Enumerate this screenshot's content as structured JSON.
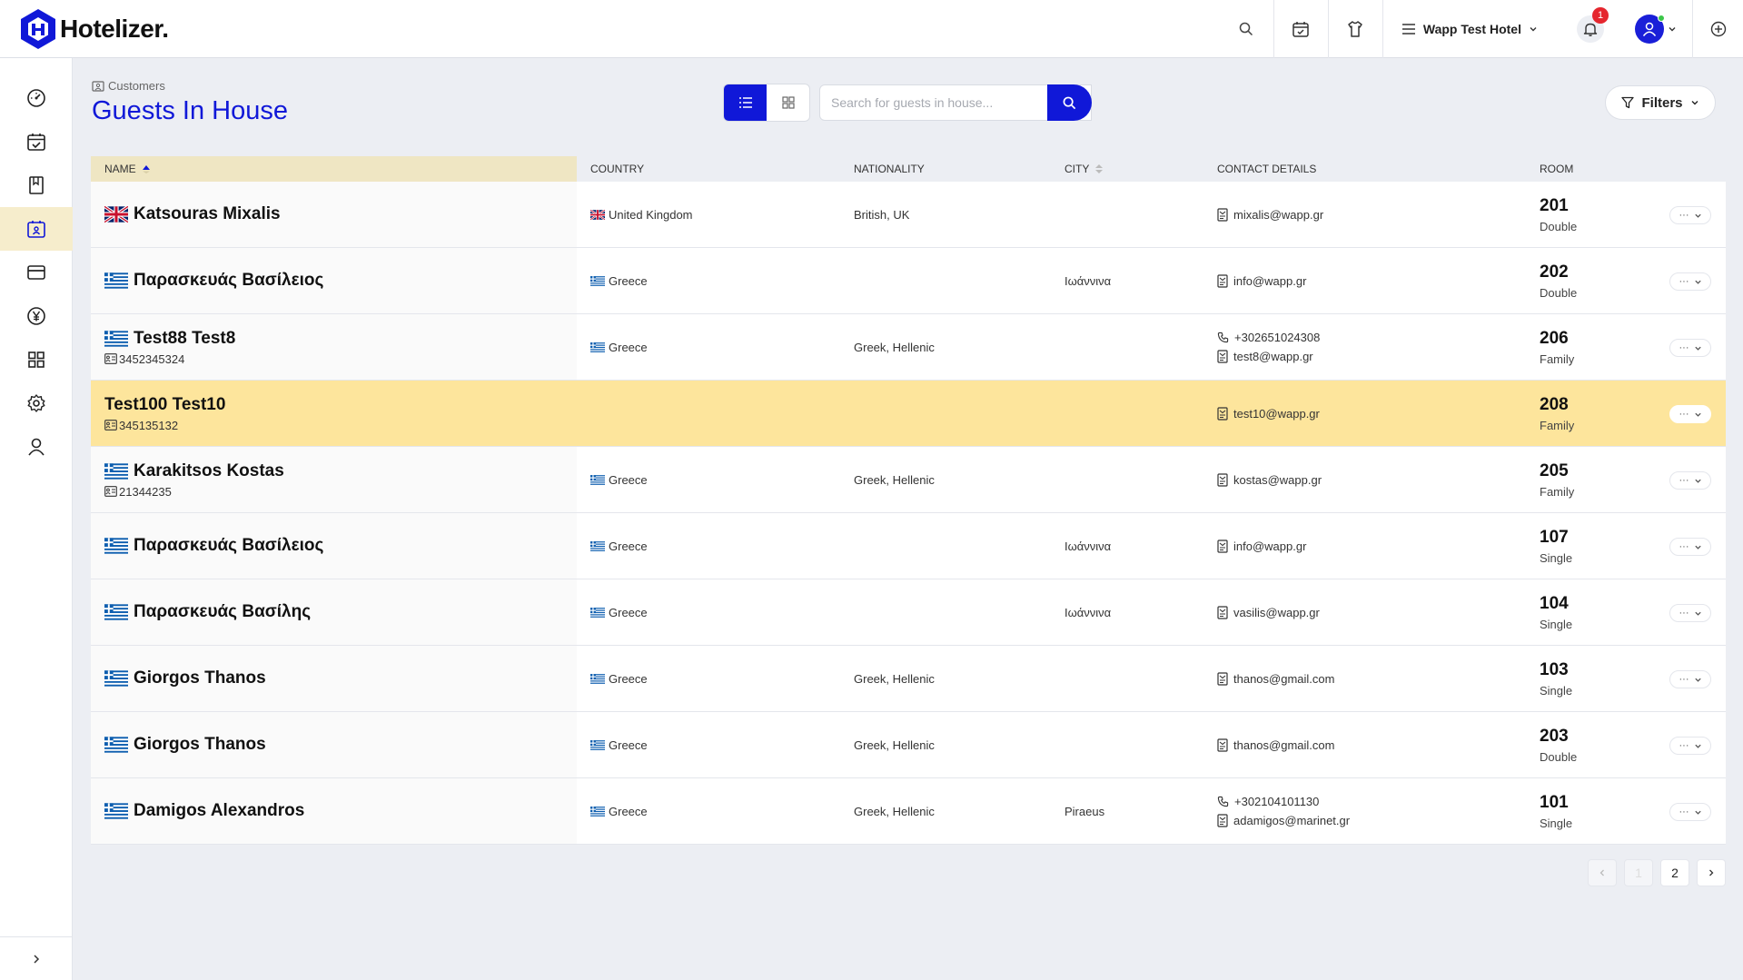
{
  "app": {
    "name": "Hotelizer."
  },
  "topbar": {
    "hotel_name": "Wapp Test Hotel",
    "notification_count": "1"
  },
  "breadcrumb": {
    "label": "Customers"
  },
  "page": {
    "title": "Guests In House"
  },
  "search": {
    "placeholder": "Search for guests in house..."
  },
  "filters": {
    "label": "Filters"
  },
  "columns": {
    "name": "NAME",
    "country": "COUNTRY",
    "nationality": "NATIONALITY",
    "city": "CITY",
    "contact": "CONTACT DETAILS",
    "room": "ROOM"
  },
  "guests": [
    {
      "name": "Katsouras Mixalis",
      "flag": "uk",
      "id": "",
      "country": "United Kingdom",
      "country_flag": "uk",
      "nationality": "British, UK",
      "city": "",
      "phone": "",
      "email": "mixalis@wapp.gr",
      "room": "201",
      "room_type": "Double",
      "highlight": false
    },
    {
      "name": "Παρασκευάς Βασίλειος",
      "flag": "gr",
      "id": "",
      "country": "Greece",
      "country_flag": "gr",
      "nationality": "",
      "city": "Ιωάννινα",
      "phone": "",
      "email": "info@wapp.gr",
      "room": "202",
      "room_type": "Double",
      "highlight": false
    },
    {
      "name": "Test88 Test8",
      "flag": "gr",
      "id": "3452345324",
      "country": "Greece",
      "country_flag": "gr",
      "nationality": "Greek, Hellenic",
      "city": "",
      "phone": "+302651024308",
      "email": "test8@wapp.gr",
      "room": "206",
      "room_type": "Family",
      "highlight": false
    },
    {
      "name": "Test100 Test10",
      "flag": "",
      "id": "345135132",
      "country": "",
      "country_flag": "",
      "nationality": "",
      "city": "",
      "phone": "",
      "email": "test10@wapp.gr",
      "room": "208",
      "room_type": "Family",
      "highlight": true
    },
    {
      "name": "Karakitsos Kostas",
      "flag": "gr",
      "id": "21344235",
      "country": "Greece",
      "country_flag": "gr",
      "nationality": "Greek, Hellenic",
      "city": "",
      "phone": "",
      "email": "kostas@wapp.gr",
      "room": "205",
      "room_type": "Family",
      "highlight": false
    },
    {
      "name": "Παρασκευάς Βασίλειος",
      "flag": "gr",
      "id": "",
      "country": "Greece",
      "country_flag": "gr",
      "nationality": "",
      "city": "Ιωάννινα",
      "phone": "",
      "email": "info@wapp.gr",
      "room": "107",
      "room_type": "Single",
      "highlight": false
    },
    {
      "name": "Παρασκευάς Βασίλης",
      "flag": "gr",
      "id": "",
      "country": "Greece",
      "country_flag": "gr",
      "nationality": "",
      "city": "Ιωάννινα",
      "phone": "",
      "email": "vasilis@wapp.gr",
      "room": "104",
      "room_type": "Single",
      "highlight": false
    },
    {
      "name": "Giorgos Thanos",
      "flag": "gr",
      "id": "",
      "country": "Greece",
      "country_flag": "gr",
      "nationality": "Greek, Hellenic",
      "city": "",
      "phone": "",
      "email": "thanos@gmail.com",
      "room": "103",
      "room_type": "Single",
      "highlight": false
    },
    {
      "name": "Giorgos Thanos",
      "flag": "gr",
      "id": "",
      "country": "Greece",
      "country_flag": "gr",
      "nationality": "Greek, Hellenic",
      "city": "",
      "phone": "",
      "email": "thanos@gmail.com",
      "room": "203",
      "room_type": "Double",
      "highlight": false
    },
    {
      "name": "Damigos Alexandros",
      "flag": "gr",
      "id": "",
      "country": "Greece",
      "country_flag": "gr",
      "nationality": "Greek, Hellenic",
      "city": "Piraeus",
      "phone": "+302104101130",
      "email": "adamigos@marinet.gr",
      "room": "101",
      "room_type": "Single",
      "highlight": false
    }
  ],
  "pagination": {
    "pages": [
      "1",
      "2"
    ],
    "current": "1"
  },
  "colors": {
    "brand": "#1018d8",
    "highlight": "#fde59c",
    "sidebar_active": "#f6edcc",
    "badge": "#e5262e"
  },
  "icons": {
    "sidebar": [
      "dashboard-icon",
      "calendar-check-icon",
      "bookmark-icon",
      "guests-in-house-icon",
      "card-icon",
      "yen-coin-icon",
      "grid-icon",
      "gear-icon",
      "user-icon"
    ]
  }
}
